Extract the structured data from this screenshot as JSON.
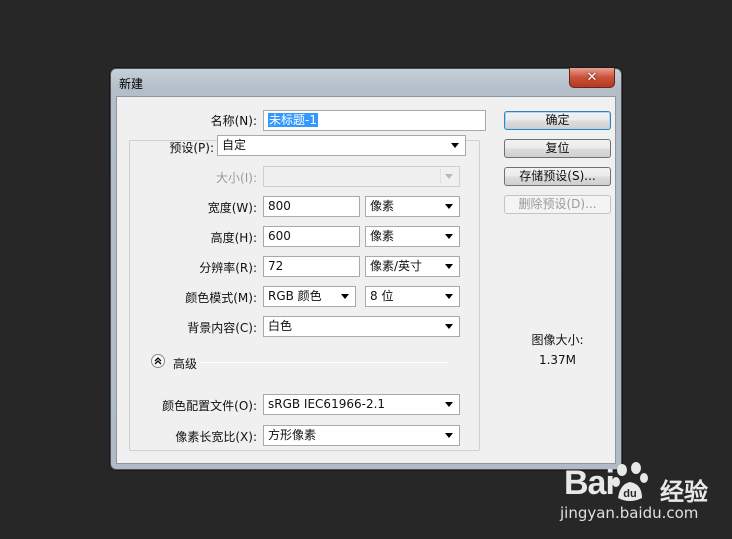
{
  "dialog": {
    "title": "新建",
    "close_symbol": "✕"
  },
  "form": {
    "name": {
      "label": "名称(N):",
      "value": "未标题-1"
    },
    "preset": {
      "label": "预设(P):",
      "value": "自定"
    },
    "size": {
      "label": "大小(I):",
      "value": ""
    },
    "width": {
      "label": "宽度(W):",
      "value": "800",
      "unit": "像素"
    },
    "height": {
      "label": "高度(H):",
      "value": "600",
      "unit": "像素"
    },
    "resolution": {
      "label": "分辨率(R):",
      "value": "72",
      "unit": "像素/英寸"
    },
    "color_mode": {
      "label": "颜色模式(M):",
      "value": "RGB 颜色",
      "depth": "8 位"
    },
    "background": {
      "label": "背景内容(C):",
      "value": "白色"
    },
    "advanced_label": "高级",
    "color_profile": {
      "label": "颜色配置文件(O):",
      "value": "sRGB IEC61966-2.1"
    },
    "pixel_aspect": {
      "label": "像素长宽比(X):",
      "value": "方形像素"
    }
  },
  "buttons": {
    "ok": "确定",
    "reset": "复位",
    "save_preset": "存储预设(S)...",
    "delete_preset": "删除预设(D)..."
  },
  "image_size": {
    "label": "图像大小:",
    "value": "1.37M"
  },
  "watermark": {
    "brand": "Bai",
    "brand_suffix": "经验",
    "url": "jingyan.baidu.com"
  }
}
